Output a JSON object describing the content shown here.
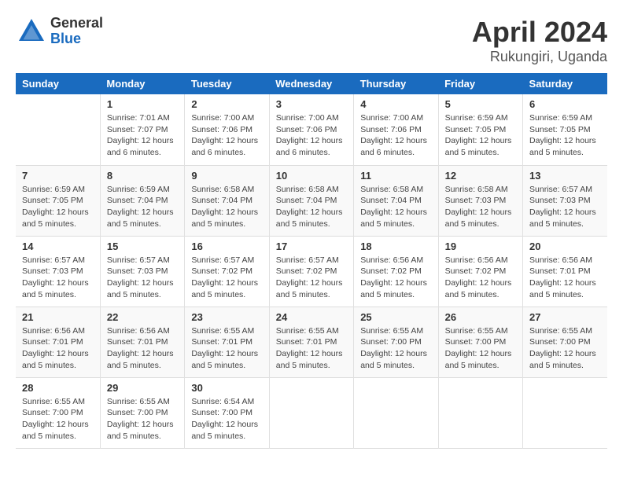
{
  "logo": {
    "general": "General",
    "blue": "Blue"
  },
  "title": "April 2024",
  "subtitle": "Rukungiri, Uganda",
  "days": [
    "Sunday",
    "Monday",
    "Tuesday",
    "Wednesday",
    "Thursday",
    "Friday",
    "Saturday"
  ],
  "weeks": [
    [
      {
        "day": "",
        "info": ""
      },
      {
        "day": "1",
        "info": "Sunrise: 7:01 AM\nSunset: 7:07 PM\nDaylight: 12 hours\nand 6 minutes."
      },
      {
        "day": "2",
        "info": "Sunrise: 7:00 AM\nSunset: 7:06 PM\nDaylight: 12 hours\nand 6 minutes."
      },
      {
        "day": "3",
        "info": "Sunrise: 7:00 AM\nSunset: 7:06 PM\nDaylight: 12 hours\nand 6 minutes."
      },
      {
        "day": "4",
        "info": "Sunrise: 7:00 AM\nSunset: 7:06 PM\nDaylight: 12 hours\nand 6 minutes."
      },
      {
        "day": "5",
        "info": "Sunrise: 6:59 AM\nSunset: 7:05 PM\nDaylight: 12 hours\nand 5 minutes."
      },
      {
        "day": "6",
        "info": "Sunrise: 6:59 AM\nSunset: 7:05 PM\nDaylight: 12 hours\nand 5 minutes."
      }
    ],
    [
      {
        "day": "7",
        "info": "Sunrise: 6:59 AM\nSunset: 7:05 PM\nDaylight: 12 hours\nand 5 minutes."
      },
      {
        "day": "8",
        "info": "Sunrise: 6:59 AM\nSunset: 7:04 PM\nDaylight: 12 hours\nand 5 minutes."
      },
      {
        "day": "9",
        "info": "Sunrise: 6:58 AM\nSunset: 7:04 PM\nDaylight: 12 hours\nand 5 minutes."
      },
      {
        "day": "10",
        "info": "Sunrise: 6:58 AM\nSunset: 7:04 PM\nDaylight: 12 hours\nand 5 minutes."
      },
      {
        "day": "11",
        "info": "Sunrise: 6:58 AM\nSunset: 7:04 PM\nDaylight: 12 hours\nand 5 minutes."
      },
      {
        "day": "12",
        "info": "Sunrise: 6:58 AM\nSunset: 7:03 PM\nDaylight: 12 hours\nand 5 minutes."
      },
      {
        "day": "13",
        "info": "Sunrise: 6:57 AM\nSunset: 7:03 PM\nDaylight: 12 hours\nand 5 minutes."
      }
    ],
    [
      {
        "day": "14",
        "info": "Sunrise: 6:57 AM\nSunset: 7:03 PM\nDaylight: 12 hours\nand 5 minutes."
      },
      {
        "day": "15",
        "info": "Sunrise: 6:57 AM\nSunset: 7:03 PM\nDaylight: 12 hours\nand 5 minutes."
      },
      {
        "day": "16",
        "info": "Sunrise: 6:57 AM\nSunset: 7:02 PM\nDaylight: 12 hours\nand 5 minutes."
      },
      {
        "day": "17",
        "info": "Sunrise: 6:57 AM\nSunset: 7:02 PM\nDaylight: 12 hours\nand 5 minutes."
      },
      {
        "day": "18",
        "info": "Sunrise: 6:56 AM\nSunset: 7:02 PM\nDaylight: 12 hours\nand 5 minutes."
      },
      {
        "day": "19",
        "info": "Sunrise: 6:56 AM\nSunset: 7:02 PM\nDaylight: 12 hours\nand 5 minutes."
      },
      {
        "day": "20",
        "info": "Sunrise: 6:56 AM\nSunset: 7:01 PM\nDaylight: 12 hours\nand 5 minutes."
      }
    ],
    [
      {
        "day": "21",
        "info": "Sunrise: 6:56 AM\nSunset: 7:01 PM\nDaylight: 12 hours\nand 5 minutes."
      },
      {
        "day": "22",
        "info": "Sunrise: 6:56 AM\nSunset: 7:01 PM\nDaylight: 12 hours\nand 5 minutes."
      },
      {
        "day": "23",
        "info": "Sunrise: 6:55 AM\nSunset: 7:01 PM\nDaylight: 12 hours\nand 5 minutes."
      },
      {
        "day": "24",
        "info": "Sunrise: 6:55 AM\nSunset: 7:01 PM\nDaylight: 12 hours\nand 5 minutes."
      },
      {
        "day": "25",
        "info": "Sunrise: 6:55 AM\nSunset: 7:00 PM\nDaylight: 12 hours\nand 5 minutes."
      },
      {
        "day": "26",
        "info": "Sunrise: 6:55 AM\nSunset: 7:00 PM\nDaylight: 12 hours\nand 5 minutes."
      },
      {
        "day": "27",
        "info": "Sunrise: 6:55 AM\nSunset: 7:00 PM\nDaylight: 12 hours\nand 5 minutes."
      }
    ],
    [
      {
        "day": "28",
        "info": "Sunrise: 6:55 AM\nSunset: 7:00 PM\nDaylight: 12 hours\nand 5 minutes."
      },
      {
        "day": "29",
        "info": "Sunrise: 6:55 AM\nSunset: 7:00 PM\nDaylight: 12 hours\nand 5 minutes."
      },
      {
        "day": "30",
        "info": "Sunrise: 6:54 AM\nSunset: 7:00 PM\nDaylight: 12 hours\nand 5 minutes."
      },
      {
        "day": "",
        "info": ""
      },
      {
        "day": "",
        "info": ""
      },
      {
        "day": "",
        "info": ""
      },
      {
        "day": "",
        "info": ""
      }
    ]
  ]
}
